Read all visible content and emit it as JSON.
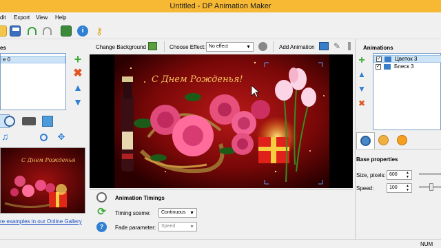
{
  "window": {
    "title": "Untitled - DP Animation Maker"
  },
  "menu": [
    "dit",
    "Export",
    "View",
    "Help"
  ],
  "left_panel": {
    "header": "es",
    "list_items": [
      "e 0"
    ],
    "gallery_link": "re examples in our Online Gallery"
  },
  "canvas_toolbar": {
    "change_background": "Change Background",
    "choose_effect": "Choose Effect:",
    "effect_value": "No effect",
    "add_animation": "Add Animation"
  },
  "canvas": {
    "greeting": "С Днем Рожденья!"
  },
  "timings": {
    "title": "Animation Timings",
    "timing_label": "Timing sceme:",
    "timing_value": "Continuous",
    "fade_label": "Fade parameter:",
    "fade_value": "Speed"
  },
  "animations": {
    "title": "Animations",
    "items": [
      {
        "name": "Цветок 3",
        "checked": true,
        "selected": true
      },
      {
        "name": "Блеск 3",
        "checked": true,
        "selected": false
      }
    ]
  },
  "base_properties": {
    "title": "Base properties",
    "size_label": "Size, pixels:",
    "size_value": "600",
    "speed_label": "Speed:",
    "speed_value": "100"
  },
  "status": {
    "num": "NUM"
  },
  "colors": {
    "titlebar": "#f7b833",
    "accent": "#2f7fd3",
    "add": "#3bab35",
    "delete": "#e05522"
  }
}
